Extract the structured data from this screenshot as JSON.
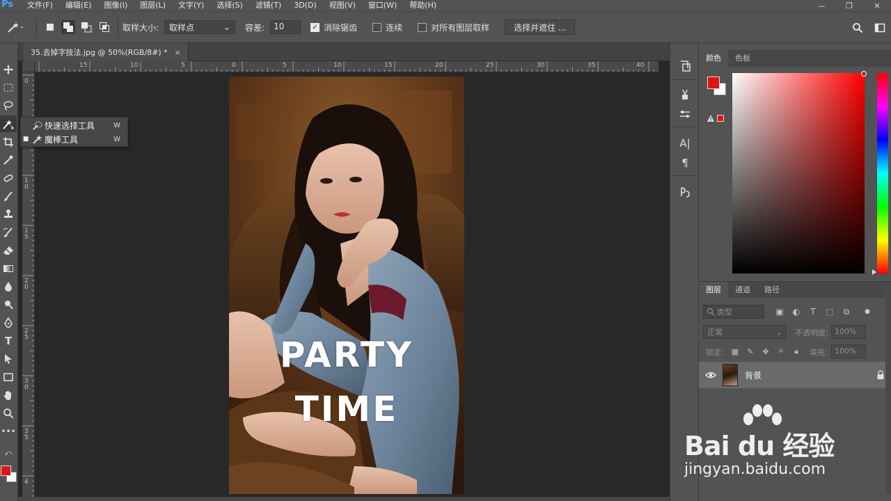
{
  "app": {
    "logo": "Ps",
    "menu": [
      "文件(F)",
      "编辑(E)",
      "图像(I)",
      "图层(L)",
      "文字(Y)",
      "选择(S)",
      "滤镜(T)",
      "3D(D)",
      "视图(V)",
      "窗口(W)",
      "帮助(H)"
    ],
    "window_controls": {
      "minimize": "—",
      "maximize": "❐",
      "close": "✕"
    }
  },
  "options": {
    "sample_size_label": "取样大小:",
    "sample_size_value": "取样点",
    "tolerance_label": "容差:",
    "tolerance_value": "10",
    "antialias_label": "消除锯齿",
    "antialias_checked": true,
    "contiguous_label": "连续",
    "contiguous_checked": false,
    "all_layers_label": "对所有图层取样",
    "all_layers_checked": false,
    "select_mask_button": "选择并遮住 ..."
  },
  "document": {
    "tab_title": "35.去掉字技法.jpg @ 50%(RGB/8#) *",
    "close_icon": "×",
    "overlay_text_line1": "PARTY",
    "overlay_text_line2": "TIME"
  },
  "rulers": {
    "horizontal": [
      "15",
      "10",
      "5",
      "0",
      "5",
      "10",
      "15",
      "20",
      "25",
      "30",
      "35",
      "40"
    ],
    "vertical": [
      "0",
      "5",
      "1 0",
      "1 5",
      "2 0",
      "2 5",
      "3 0",
      "3 5",
      "4"
    ]
  },
  "flyout": {
    "items": [
      {
        "label": "快速选择工具",
        "shortcut": "W",
        "active": false
      },
      {
        "label": "魔棒工具",
        "shortcut": "W",
        "active": true
      }
    ]
  },
  "panels": {
    "color_tabs": [
      "颜色",
      "色板"
    ],
    "layers_tabs": [
      "图层",
      "通道",
      "路径"
    ],
    "layers_filter_placeholder": "类型",
    "blend_mode": "正常",
    "opacity_label": "不透明度:",
    "opacity_value": "100%",
    "lock_label": "锁定:",
    "fill_label": "填充:",
    "fill_value": "100%",
    "layers": [
      {
        "name": "背景",
        "visible": true,
        "locked": true
      }
    ]
  },
  "colors": {
    "foreground": "#e11212",
    "background": "#ffffff",
    "accent": "#4aa3ff"
  },
  "watermark": {
    "brand": "Bai du 经验",
    "url": "jingyan.baidu.com"
  }
}
